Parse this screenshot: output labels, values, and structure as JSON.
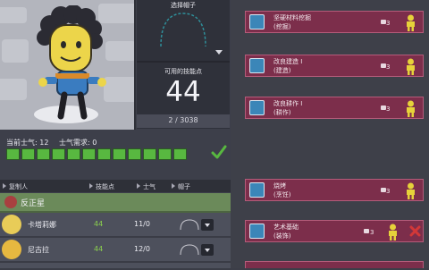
{
  "hat_selector": {
    "title": "选择帽子"
  },
  "skill_points": {
    "label": "可用的技能点",
    "value": "44",
    "xp_progress": "2 / 3038"
  },
  "morale": {
    "current_label": "当前士气: 12",
    "required_label": "士气需求: 0",
    "filled_segments": 12,
    "check_icon": "checkmark-icon"
  },
  "list_header": {
    "col_name": "复制人",
    "col_points": "技能点",
    "col_morale": "士气",
    "col_hat": "帽子"
  },
  "group": {
    "name": "反正星"
  },
  "dupes": [
    {
      "name": "卡塔莉娜",
      "points": "44",
      "morale": "11/0"
    },
    {
      "name": "尼古拉",
      "points": "44",
      "morale": "12/0"
    }
  ],
  "skills": [
    {
      "name": "坚硬材料挖掘",
      "category": "(挖掘)",
      "count": "3",
      "icon": "shovel-icon",
      "status": "person-icon"
    },
    {
      "name": "改良建造 I",
      "category": "(建造)",
      "count": "3",
      "icon": "wrench-icon",
      "status": "person-icon"
    },
    {
      "name": "改良耕作 I",
      "category": "(耕作)",
      "count": "3",
      "icon": "plant-icon",
      "status": "person-icon"
    },
    {
      "name": "烧烤",
      "category": "(烹饪)",
      "count": "3",
      "icon": "grill-icon",
      "status": "person-icon"
    },
    {
      "name": "艺术基础",
      "category": "(装饰)",
      "count": "3",
      "icon": "paintbrush-icon",
      "status": "x-icon"
    }
  ],
  "colors": {
    "skill_card": "#7c2e4b",
    "morale_ok": "#58b840",
    "group_row": "#6b8a5a",
    "points_green": "#8bd04e"
  }
}
